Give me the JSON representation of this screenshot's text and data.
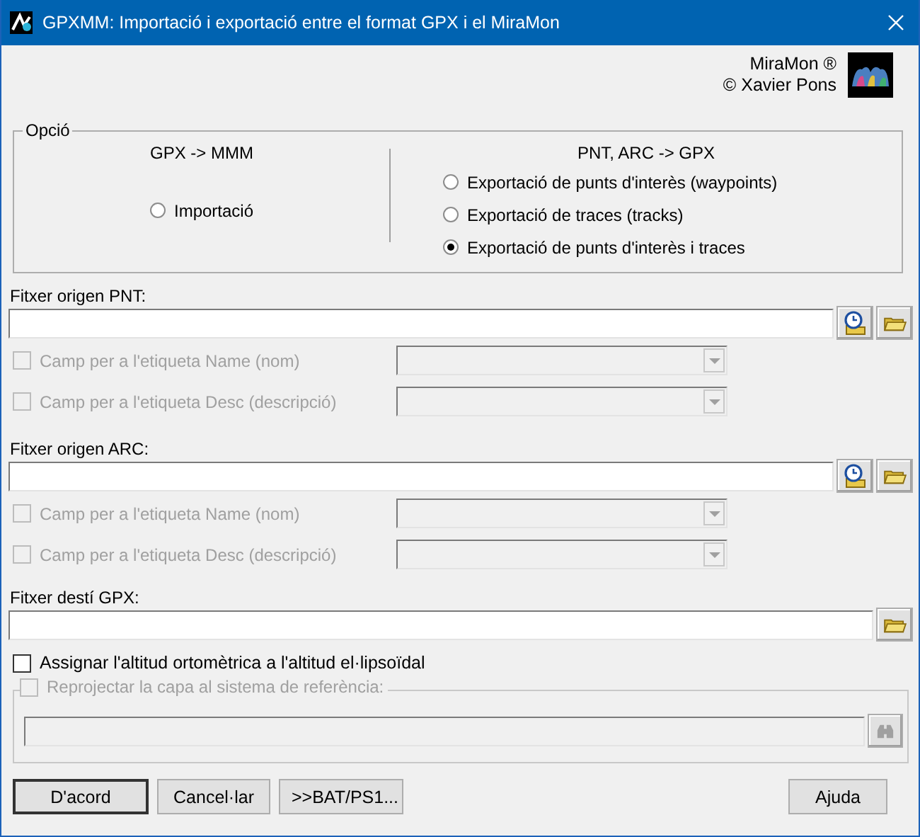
{
  "window": {
    "title": "GPXMM: Importació i exportació entre el format GPX i el MiraMon"
  },
  "credits": {
    "product": "MiraMon ®",
    "author": "© Xavier Pons"
  },
  "option_group": {
    "label": "Opció",
    "import_heading": "GPX -> MMM",
    "export_heading": "PNT, ARC -> GPX",
    "options": [
      {
        "kind": "import",
        "label": "Importació",
        "selected": false
      },
      {
        "kind": "export",
        "label": "Exportació de punts d'interès (waypoints)",
        "selected": false
      },
      {
        "kind": "export",
        "label": "Exportació de traces (tracks)",
        "selected": false
      },
      {
        "kind": "export",
        "label": "Exportació de punts d'interès i traces",
        "selected": true
      }
    ]
  },
  "sources": [
    {
      "label": "Fitxer origen PNT:",
      "fields": [
        {
          "label": "Camp per a l'etiqueta Name (nom)",
          "checked": false,
          "disabled": true
        },
        {
          "label": "Camp per a l'etiqueta Desc (descripció)",
          "checked": false,
          "disabled": true
        }
      ]
    },
    {
      "label": "Fitxer origen ARC:",
      "fields": [
        {
          "label": "Camp per a l'etiqueta Name (nom)",
          "checked": false,
          "disabled": true
        },
        {
          "label": "Camp per a l'etiqueta Desc (descripció)",
          "checked": false,
          "disabled": true
        }
      ]
    }
  ],
  "destination": {
    "label": "Fitxer destí GPX:"
  },
  "assign_altitude": {
    "label": "Assignar l'altitud ortomètrica a l'altitud el·lipsoïdal",
    "checked": false,
    "disabled": false
  },
  "reproject": {
    "label": "Reprojectar la capa al sistema de referència:",
    "checked": false,
    "disabled": true
  },
  "buttons": [
    {
      "label": "D'acord",
      "default": true
    },
    {
      "label": "Cancel·lar",
      "default": false
    },
    {
      "label": ">>BAT/PS1...",
      "default": false
    },
    {
      "label": "Ajuda",
      "default": false
    }
  ]
}
